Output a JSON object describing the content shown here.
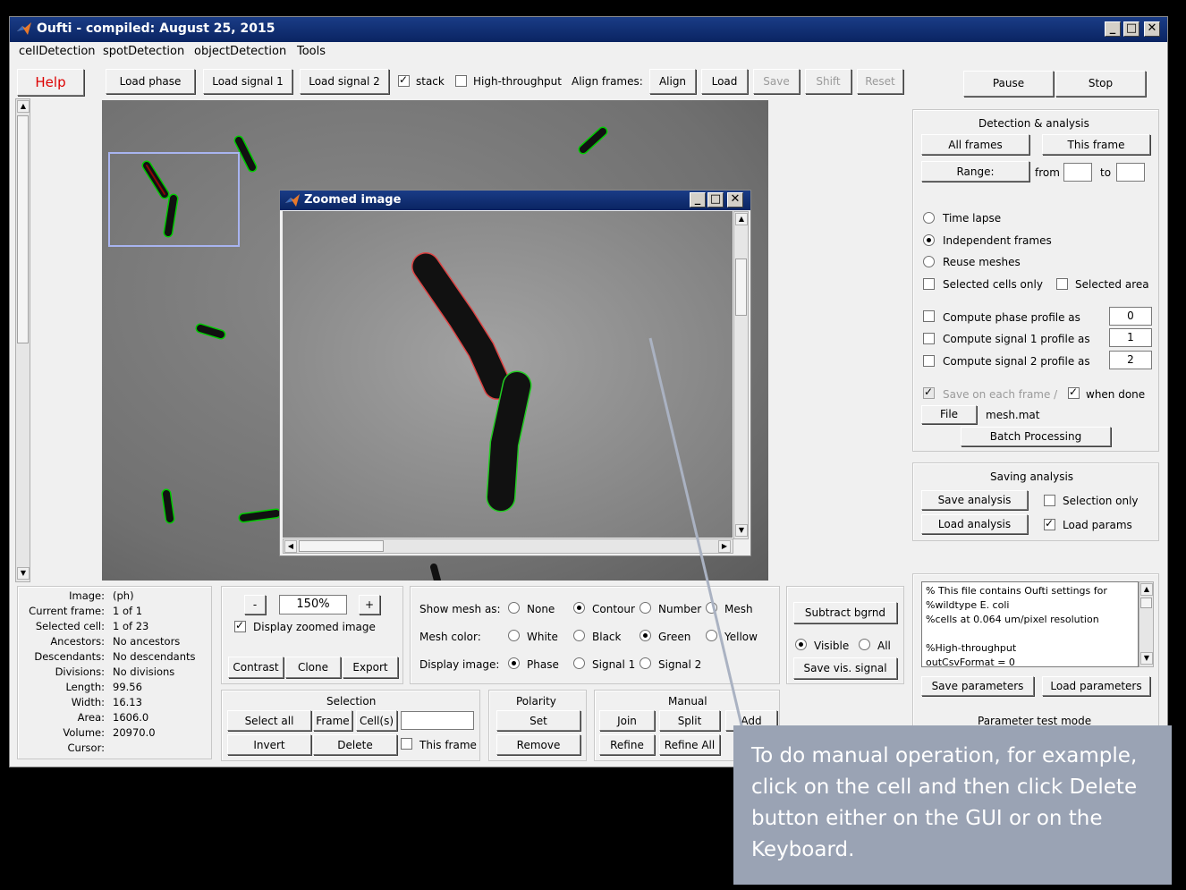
{
  "window": {
    "title": "Oufti - compiled:  August 25, 2015"
  },
  "menubar": [
    "cellDetection",
    "spotDetection",
    "objectDetection",
    "Tools"
  ],
  "toolbar": {
    "help": "Help",
    "load_phase": "Load phase",
    "load_signal1": "Load signal 1",
    "load_signal2": "Load signal 2",
    "stack": "stack",
    "high_throughput": "High-throughput",
    "align_frames": "Align frames:",
    "align": "Align",
    "load": "Load",
    "save": "Save",
    "shift": "Shift",
    "reset": "Reset",
    "pause": "Pause",
    "stop": "Stop"
  },
  "detection": {
    "title": "Detection & analysis",
    "all_frames": "All frames",
    "this_frame": "This frame",
    "range": "Range:",
    "from": "from",
    "to": "to",
    "time_lapse": "Time lapse",
    "independent_frames": "Independent frames",
    "reuse_meshes": "Reuse meshes",
    "selected_cells_only": "Selected cells only",
    "selected_area": "Selected area",
    "compute_phase": "Compute phase profile as",
    "compute_signal1": "Compute signal 1 profile as",
    "compute_signal2": "Compute signal 2 profile as",
    "phase_val": "0",
    "signal1_val": "1",
    "signal2_val": "2",
    "save_on_each": "Save on each frame /",
    "when_done": "when done",
    "file": "File",
    "filename": "mesh.mat",
    "batch": "Batch Processing"
  },
  "saving": {
    "title": "Saving analysis",
    "save_analysis": "Save analysis",
    "selection_only": "Selection only",
    "load_analysis": "Load analysis",
    "load_params": "Load params"
  },
  "params": {
    "lines": [
      "% This file contains Oufti settings for",
      "%wildtype E. coli",
      "%cells at 0.064 um/pixel resolution",
      "",
      "%High-throughput",
      "outCsvFormat = 0"
    ],
    "save_parameters": "Save parameters",
    "load_parameters": "Load parameters",
    "test_mode": "Parameter test mode"
  },
  "info": {
    "labels": [
      "Image:",
      "Current frame:",
      "Selected cell:",
      "Ancestors:",
      "Descendants:",
      "Divisions:",
      "Length:",
      "Width:",
      "Area:",
      "Volume:",
      "Cursor:"
    ],
    "values": [
      "(ph)",
      "1 of 1",
      "1 of 23",
      "No ancestors",
      "No descendants",
      "No divisions",
      "99.56",
      "16.13",
      "1606.0",
      "20970.0",
      ""
    ]
  },
  "zoom_controls": {
    "minus": "-",
    "value": "150%",
    "plus": "+",
    "display_zoomed": "Display zoomed image",
    "contrast": "Contrast",
    "clone": "Clone",
    "export": "Export"
  },
  "mesh": {
    "show_mesh_as": "Show mesh as:",
    "none": "None",
    "contour": "Contour",
    "number": "Number",
    "mesh": "Mesh",
    "mesh_color": "Mesh color:",
    "white": "White",
    "black": "Black",
    "green": "Green",
    "yellow": "Yellow",
    "display_image": "Display image:",
    "phase": "Phase",
    "signal1": "Signal 1",
    "signal2": "Signal 2"
  },
  "bg": {
    "subtract": "Subtract bgrnd",
    "visible": "Visible",
    "all": "All",
    "save_vis": "Save vis. signal"
  },
  "selection": {
    "title": "Selection",
    "select_all": "Select all",
    "frame": "Frame",
    "cells": "Cell(s)",
    "invert": "Invert",
    "delete": "Delete",
    "this_frame": "This frame"
  },
  "polarity": {
    "title": "Polarity",
    "set": "Set",
    "remove": "Remove"
  },
  "manual": {
    "title": "Manual",
    "join": "Join",
    "split": "Split",
    "add": "Add",
    "refine": "Refine",
    "refine_all": "Refine All"
  },
  "zoom_window": {
    "title": "Zoomed image"
  },
  "callout": {
    "text": "To do manual operation, for example, click on the cell and then click  Delete button either on the GUI or on the Keyboard."
  }
}
